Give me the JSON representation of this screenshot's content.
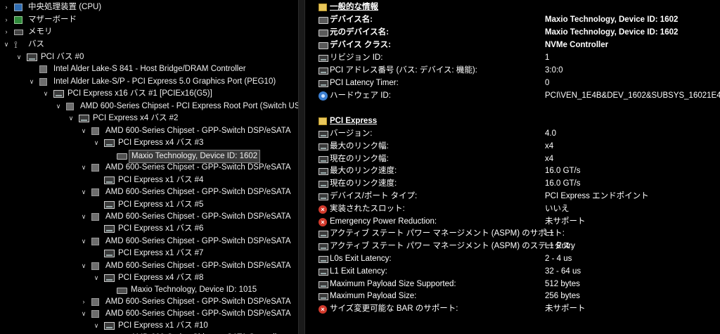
{
  "tree": {
    "nodes": [
      {
        "label": "中央処理装置 (CPU)",
        "icon": "cpu-icon",
        "expander": "collapsed"
      },
      {
        "label": "マザーボード",
        "icon": "motherboard-icon",
        "expander": "collapsed"
      },
      {
        "label": "メモリ",
        "icon": "memory-icon",
        "expander": "collapsed"
      },
      {
        "label": "バス",
        "icon": "bus-icon",
        "expander": "expanded"
      },
      {
        "label": "PCI バス #0",
        "icon": "pci-bus-icon",
        "expander": "expanded"
      },
      {
        "label": "Intel Alder Lake-S 841 - Host Bridge/DRAM Controller",
        "icon": "chip-icon",
        "expander": "none"
      },
      {
        "label": "Intel Alder Lake-S/P - PCI Express 5.0 Graphics Port (PEG10)",
        "icon": "chip-icon",
        "expander": "expanded"
      },
      {
        "label": "PCI Express x16 バス #1 [PCIEx16(G5)]",
        "icon": "pci-bus-icon",
        "expander": "expanded"
      },
      {
        "label": "AMD 600-Series Chipset - PCI Express Root Port (Switch USP)",
        "icon": "chip-icon",
        "expander": "expanded"
      },
      {
        "label": "PCI Express x4 バス #2",
        "icon": "pci-bus-icon",
        "expander": "expanded"
      },
      {
        "label": "AMD 600-Series Chipset - GPP-Switch DSP/eSATA",
        "icon": "chip-icon",
        "expander": "expanded"
      },
      {
        "label": "PCI Express x4 バス #3",
        "icon": "pci-bus-icon",
        "expander": "expanded"
      },
      {
        "label": "Maxio Technology, Device ID: 1602",
        "icon": "drive-icon",
        "expander": "none",
        "selected": true
      },
      {
        "label": "AMD 600-Series Chipset - GPP-Switch DSP/eSATA",
        "icon": "chip-icon",
        "expander": "expanded"
      },
      {
        "label": "PCI Express x1 バス #4",
        "icon": "pci-bus-icon",
        "expander": "none"
      },
      {
        "label": "AMD 600-Series Chipset - GPP-Switch DSP/eSATA",
        "icon": "chip-icon",
        "expander": "expanded"
      },
      {
        "label": "PCI Express x1 バス #5",
        "icon": "pci-bus-icon",
        "expander": "none"
      },
      {
        "label": "AMD 600-Series Chipset - GPP-Switch DSP/eSATA",
        "icon": "chip-icon",
        "expander": "expanded"
      },
      {
        "label": "PCI Express x1 バス #6",
        "icon": "pci-bus-icon",
        "expander": "none"
      },
      {
        "label": "AMD 600-Series Chipset - GPP-Switch DSP/eSATA",
        "icon": "chip-icon",
        "expander": "expanded"
      },
      {
        "label": "PCI Express x1 バス #7",
        "icon": "pci-bus-icon",
        "expander": "none"
      },
      {
        "label": "AMD 600-Series Chipset - GPP-Switch DSP/eSATA",
        "icon": "chip-icon",
        "expander": "expanded"
      },
      {
        "label": "PCI Express x4 バス #8",
        "icon": "pci-bus-icon",
        "expander": "expanded"
      },
      {
        "label": "Maxio Technology, Device ID: 1015",
        "icon": "drive-icon",
        "expander": "none"
      },
      {
        "label": "AMD 600-Series Chipset - GPP-Switch DSP/eSATA",
        "icon": "chip-icon",
        "expander": "collapsed"
      },
      {
        "label": "AMD 600-Series Chipset - GPP-Switch DSP/eSATA",
        "icon": "chip-icon",
        "expander": "expanded"
      },
      {
        "label": "PCI Express x1 バス #10",
        "icon": "pci-bus-icon",
        "expander": "expanded"
      },
      {
        "label": "AMD 600-Series Chipset - SATA Controller",
        "icon": "chip-icon",
        "expander": "none"
      }
    ]
  },
  "details": {
    "general_header": "一般的な情報",
    "general": [
      {
        "key": "デバイス名:",
        "value": "Maxio Technology, Device ID: 1602",
        "icon": "drive-icon",
        "bold": true
      },
      {
        "key": "元のデバイス名:",
        "value": "Maxio Technology, Device ID: 1602",
        "icon": "drive-icon",
        "bold": true
      },
      {
        "key": "デバイス クラス:",
        "value": "NVMe Controller",
        "icon": "drive-icon",
        "bold": true
      },
      {
        "key": "リビジョン ID:",
        "value": "1",
        "icon": "pci-icon"
      },
      {
        "key": "PCI アドレス番号 (バス: デバイス: 機能):",
        "value": "3:0:0",
        "icon": "pci-icon"
      },
      {
        "key": "PCI Latency Timer:",
        "value": "0",
        "icon": "pci-icon"
      },
      {
        "key": "ハードウェア ID:",
        "value": "PCI\\VEN_1E4B&DEV_1602&SUBSYS_16021E4B&RE",
        "icon": "hardware-icon"
      }
    ],
    "pcie_header": "PCI Express",
    "pcie": [
      {
        "key": "バージョン:",
        "value": "4.0",
        "icon": "pci-icon"
      },
      {
        "key": "最大のリンク幅:",
        "value": "x4",
        "icon": "pci-icon"
      },
      {
        "key": "現在のリンク幅:",
        "value": "x4",
        "icon": "pci-icon"
      },
      {
        "key": "最大のリンク速度:",
        "value": "16.0 GT/s",
        "icon": "pci-icon"
      },
      {
        "key": "現在のリンク速度:",
        "value": "16.0 GT/s",
        "icon": "pci-icon"
      },
      {
        "key": "デバイス/ポート タイプ:",
        "value": "PCI Express エンドポイント",
        "icon": "pci-icon"
      },
      {
        "key": "実装されたスロット:",
        "value": "いいえ",
        "icon": "error-icon"
      },
      {
        "key": "Emergency Power Reduction:",
        "value": "未サポート",
        "icon": "error-icon"
      },
      {
        "key": "アクティブ ステート パワー マネージメント (ASPM) のサポート:",
        "value": "L1",
        "icon": "pci-icon"
      },
      {
        "key": "アクティブ ステート パワー マネージメント (ASPM) のステータス:",
        "value": "L1 Entry",
        "icon": "pci-icon"
      },
      {
        "key": "L0s Exit Latency:",
        "value": "2 - 4 us",
        "icon": "pci-icon"
      },
      {
        "key": "L1 Exit Latency:",
        "value": "32 - 64 us",
        "icon": "pci-icon"
      },
      {
        "key": "Maximum Payload Size Supported:",
        "value": "512 bytes",
        "icon": "pci-icon"
      },
      {
        "key": "Maximum Payload Size:",
        "value": "256 bytes",
        "icon": "pci-icon"
      },
      {
        "key": "サイズ変更可能な BAR のサポート:",
        "value": "未サポート",
        "icon": "error-icon"
      }
    ]
  }
}
